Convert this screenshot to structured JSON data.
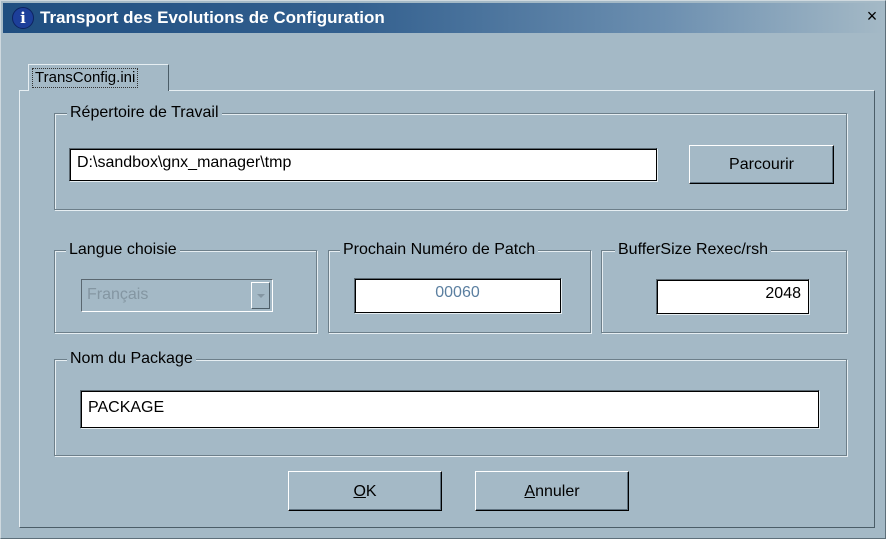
{
  "window": {
    "title": "Transport des Evolutions de Configuration",
    "close_symbol": "×",
    "info_icon": "info-icon",
    "info_glyph": "i"
  },
  "tab": {
    "label": "TransConfig.ini"
  },
  "work_dir": {
    "legend": "Répertoire de Travail",
    "value": "D:\\sandbox\\gnx_manager\\tmp",
    "browse_label": "Parcourir"
  },
  "language": {
    "legend": "Langue choisie",
    "selected": "Français"
  },
  "patch": {
    "legend": "Prochain Numéro de Patch",
    "value": "00060"
  },
  "buffer": {
    "legend": "BufferSize Rexec/rsh",
    "value": "2048"
  },
  "package": {
    "legend": "Nom du Package",
    "value": "PACKAGE"
  },
  "buttons": {
    "ok_mnemonic": "O",
    "ok_rest": "K",
    "cancel_mnemonic": "A",
    "cancel_rest": "nnuler"
  },
  "colors": {
    "background": "#a4b9c6",
    "title_gradient_start": "#1f4e80",
    "disabled_text": "#8496a2"
  }
}
